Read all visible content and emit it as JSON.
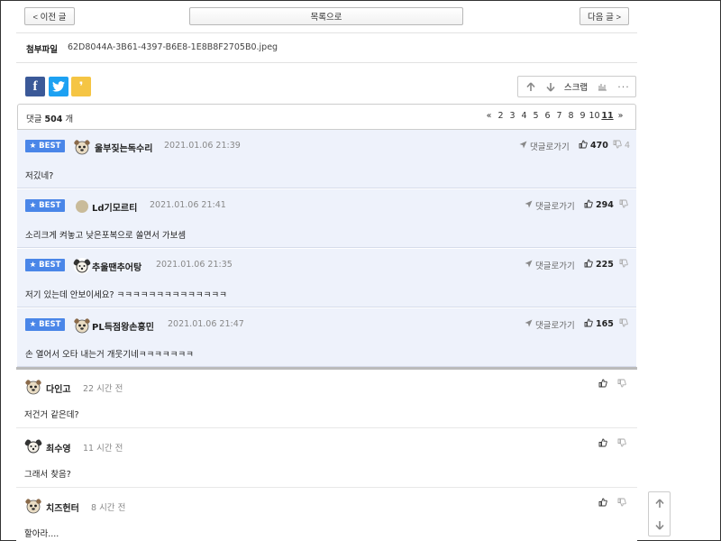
{
  "nav": {
    "prev": "< 이전 글",
    "list": "목록으로",
    "next": "다음 글 >"
  },
  "attachment": {
    "label": "첨부파일",
    "filename": "62D8044A-3B61-4397-B6E8-1E8B8F2705B0.jpeg"
  },
  "share": {
    "facebook_glyph": "f",
    "kakao_glyph": "❜"
  },
  "toolbox": {
    "scrap_label": "스크랩",
    "more_glyph": "···"
  },
  "comments": {
    "count_prefix": "댓글",
    "count": "504",
    "count_suffix": "개",
    "pager": {
      "prev": "«",
      "pages": [
        "2",
        "3",
        "4",
        "5",
        "6",
        "7",
        "8",
        "9",
        "10"
      ],
      "current": "11",
      "next": "»"
    }
  },
  "best_badge": "★ BEST",
  "reply_label": "댓글로가기",
  "best_comments": [
    {
      "nick": "울부짖는독수리",
      "date": "2021.01.06 21:39",
      "text": "저깄네?",
      "likes": "470",
      "dislikes": "4"
    },
    {
      "nick": "Ld기모르티",
      "date": "2021.01.06 21:41",
      "text": "소리크게 켜놓고 낮은포복으로 쏠면서 가보셈",
      "likes": "294",
      "dislikes": ""
    },
    {
      "nick": "추울땐추어탕",
      "date": "2021.01.06 21:35",
      "text": "저기 있는데 안보이세요? ㅋㅋㅋㅋㅋㅋㅋㅋㅋㅋㅋㅋㅋㅋ",
      "likes": "225",
      "dislikes": ""
    },
    {
      "nick": "PL득점왕손흥민",
      "date": "2021.01.06 21:47",
      "text": "손 열어서 오타 내는거 개웃기네ㅋㅋㅋㅋㅋㅋㅋ",
      "likes": "165",
      "dislikes": ""
    }
  ],
  "comments_list": [
    {
      "nick": "다인고",
      "date": "22 시간 전",
      "text": "저건거 같은데?"
    },
    {
      "nick": "최수영",
      "date": "11 시간 전",
      "text": "그래서 찾음?"
    },
    {
      "nick": "치즈헌터",
      "date": "8 시간 전",
      "text": "할아라...."
    }
  ],
  "colors": {
    "best_bg": "#eef2fb",
    "badge": "#4a86e8",
    "facebook": "#3b5998",
    "twitter": "#1da1f2",
    "kakao": "#f5c544"
  }
}
